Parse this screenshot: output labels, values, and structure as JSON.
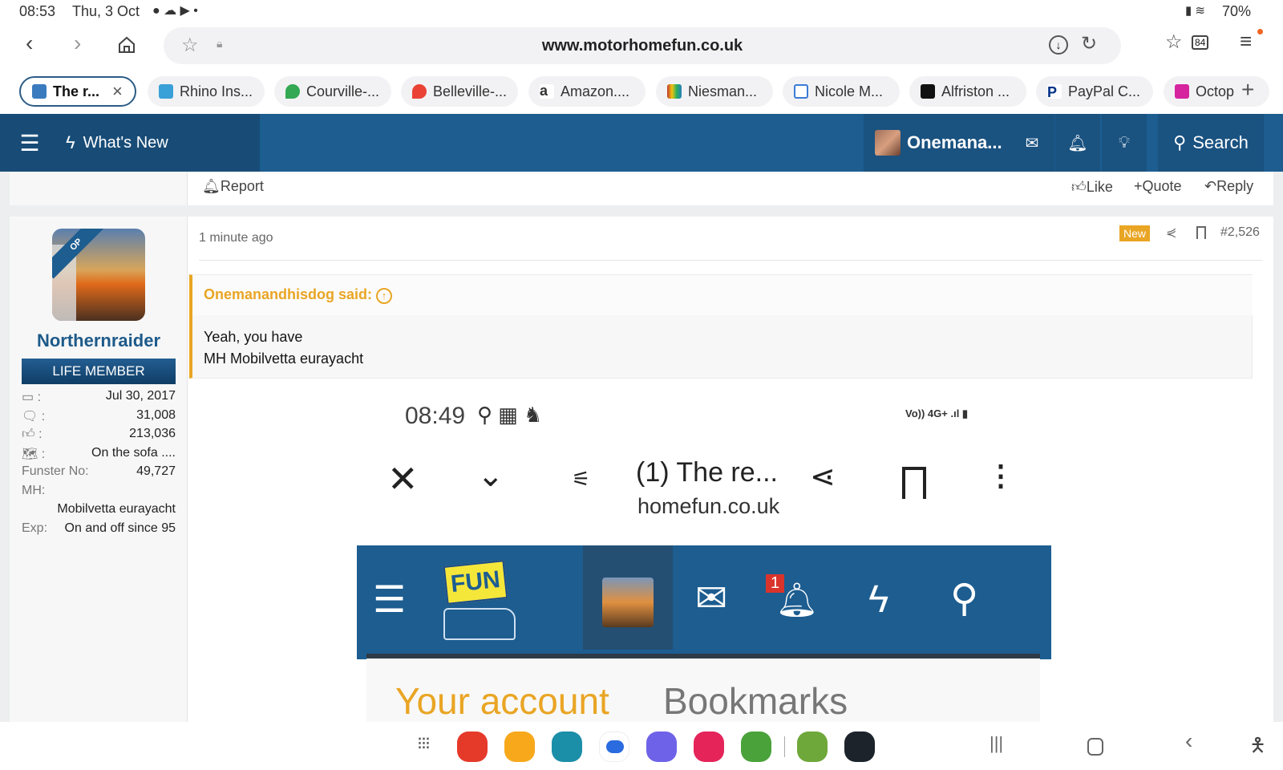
{
  "status_bar": {
    "time": "08:53",
    "date": "Thu, 3 Oct",
    "battery": "70%"
  },
  "browser": {
    "url": "www.motorhomefun.co.uk",
    "tab_count": "84",
    "tabs": [
      {
        "label": "The r...",
        "color": "#3a7bbf"
      },
      {
        "label": "Rhino Ins...",
        "color": "#3aa0d8"
      },
      {
        "label": "Courville-...",
        "color": "#34a853"
      },
      {
        "label": "Belleville-...",
        "color": "#ea4335"
      },
      {
        "label": "Amazon....",
        "color": "#222222"
      },
      {
        "label": "Niesman...",
        "color": "#c0392b"
      },
      {
        "label": "Nicole M...",
        "color": "#ffffff"
      },
      {
        "label": "Alfriston ...",
        "color": "#111111"
      },
      {
        "label": "PayPal C...",
        "color": "#003087"
      },
      {
        "label": "Octop",
        "color": "#d6249f"
      }
    ]
  },
  "site_nav": {
    "whats_new": "What's New",
    "user": "Onemana...",
    "search": "Search"
  },
  "prev_post": {
    "report": "Report",
    "like": "Like",
    "quote": "Quote",
    "reply": "Reply"
  },
  "post": {
    "author": {
      "name": "Northernraider",
      "badge": "OP",
      "rank": "LIFE MEMBER",
      "stats": [
        {
          "icon": "calendar-icon",
          "value": "Jul 30, 2017"
        },
        {
          "icon": "messages-icon",
          "value": "31,008"
        },
        {
          "icon": "thumbs-up-icon",
          "value": "213,036"
        },
        {
          "icon": "map-icon",
          "value": "On the sofa ...."
        }
      ],
      "funster_label": "Funster No:",
      "funster_no": "49,727",
      "mh_label": "MH:",
      "mh": "Mobilvetta eurayacht",
      "exp_label": "Exp:",
      "exp": "On and off since 95"
    },
    "time": "1 minute ago",
    "new_badge": "New",
    "number": "#2,526",
    "quote": {
      "author": "Onemanandhisdog said:",
      "lines": [
        "Yeah, you have",
        "MH Mobilvetta eurayacht"
      ]
    },
    "embedded": {
      "time": "08:49",
      "net": "4G+",
      "title": "(1) The re...",
      "url": "homefun.co.uk",
      "notif_count": "1",
      "logo": "MOTORHOME FUN",
      "tab_account": "Your account",
      "tab_bookmarks": "Bookmarks"
    }
  },
  "colors": {
    "nav": "#1d5d90",
    "accent": "#e9a524",
    "username": "#1d5a8a"
  }
}
